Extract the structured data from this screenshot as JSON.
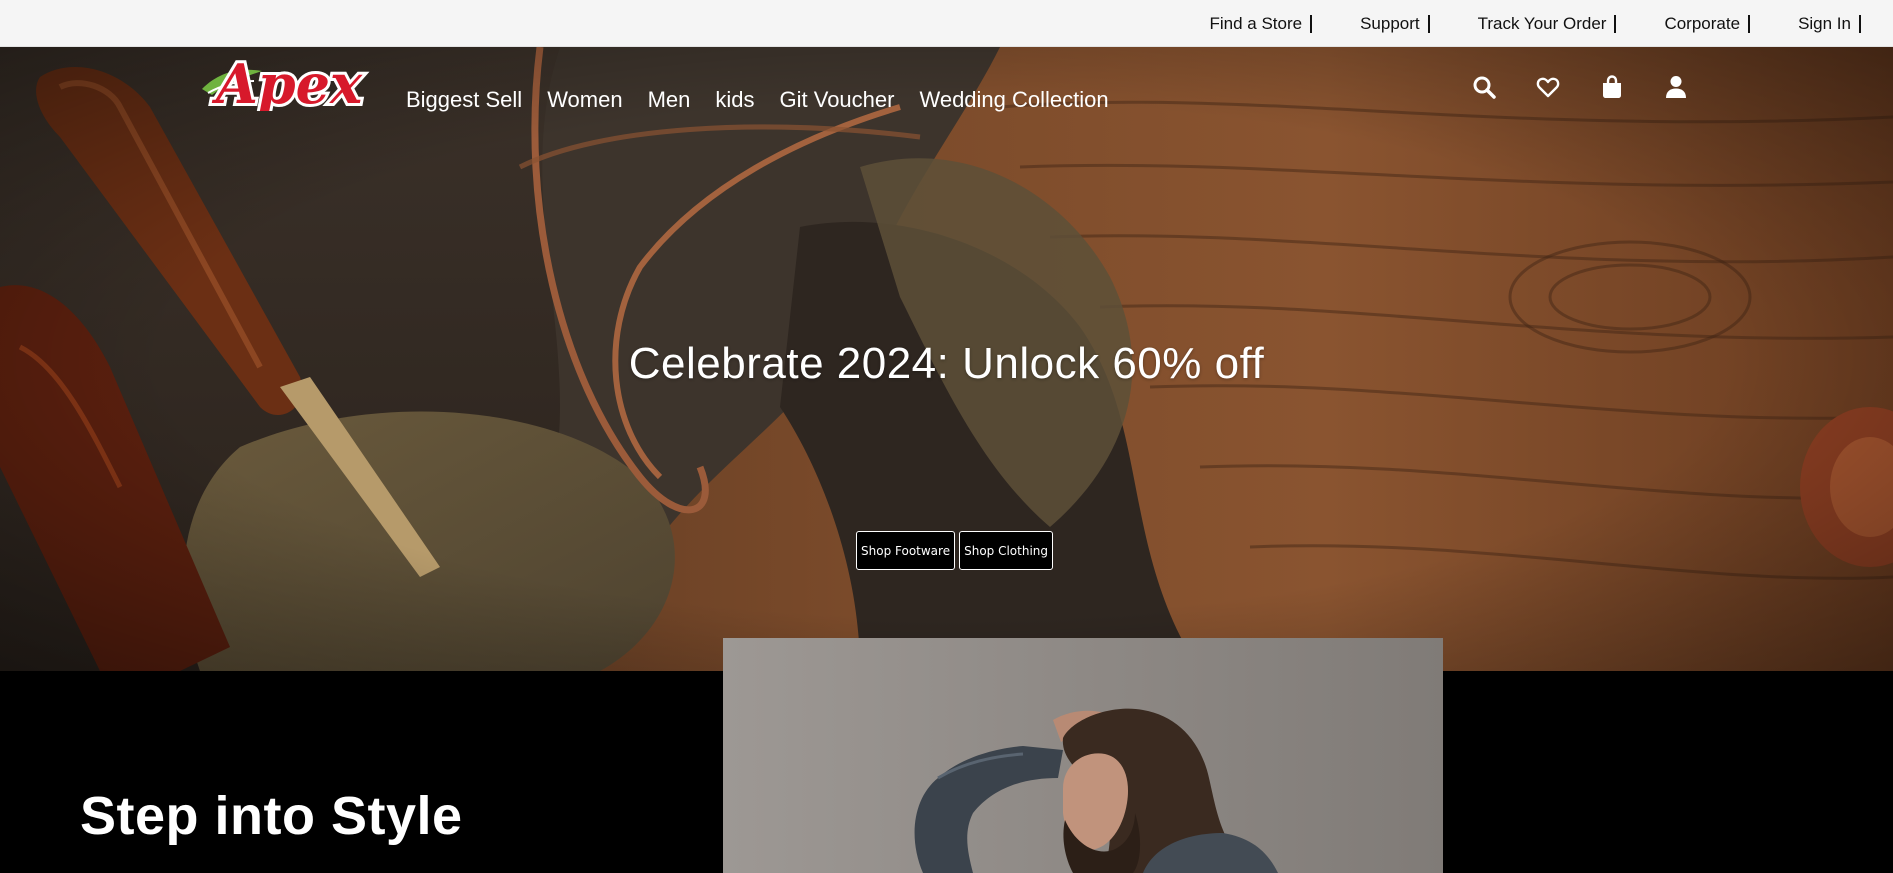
{
  "utility_nav": [
    {
      "label": "Find a Store"
    },
    {
      "label": "Support"
    },
    {
      "label": "Track Your Order"
    },
    {
      "label": "Corporate"
    },
    {
      "label": "Sign In"
    }
  ],
  "brand": {
    "name": "Apex",
    "color": "#d7192b",
    "leaf_color": "#6fb33f"
  },
  "main_nav": [
    {
      "label": "Biggest Sell"
    },
    {
      "label": "Women"
    },
    {
      "label": "Men"
    },
    {
      "label": "kids"
    },
    {
      "label": "Git Voucher"
    },
    {
      "label": "Wedding Collection"
    }
  ],
  "header_icons": [
    "search-icon",
    "heart-icon",
    "shopping-bag-icon",
    "user-icon"
  ],
  "hero": {
    "headline": "Celebrate 2024: Unlock 60% off",
    "buttons": [
      {
        "label": "Shop Footware"
      },
      {
        "label": "Shop Clothing"
      }
    ]
  },
  "style_section": {
    "title": "Step into Style"
  },
  "colors": {
    "utility_bg": "#f5f5f5",
    "section_bg": "#000000",
    "text_on_dark": "#ffffff"
  }
}
